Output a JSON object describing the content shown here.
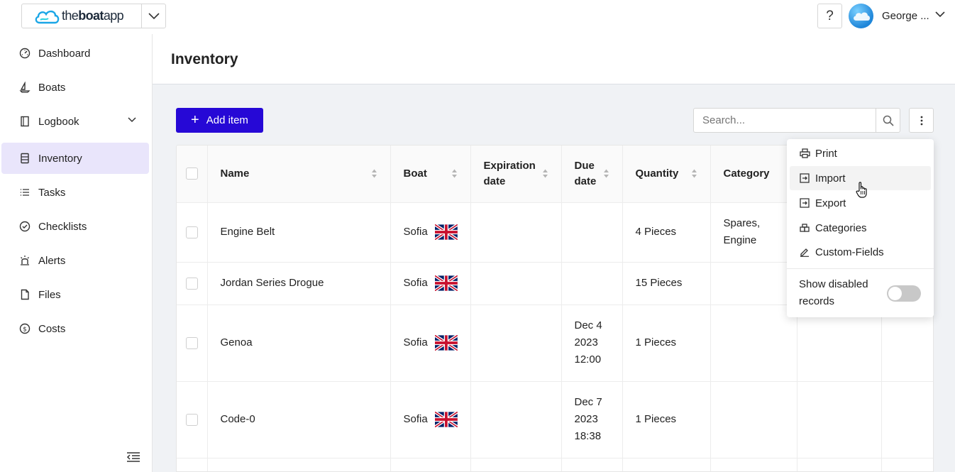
{
  "brand": {
    "prefix": "the",
    "bold": "boat",
    "suffix": "app"
  },
  "header": {
    "help_label": "?",
    "user_name": "George ..."
  },
  "sidebar": {
    "items": [
      {
        "label": "Dashboard",
        "icon": "gauge-icon"
      },
      {
        "label": "Boats",
        "icon": "sailboat-icon"
      },
      {
        "label": "Logbook",
        "icon": "book-icon"
      },
      {
        "label": "Inventory",
        "icon": "list-icon",
        "active": true
      },
      {
        "label": "Tasks",
        "icon": "tasks-icon"
      },
      {
        "label": "Checklists",
        "icon": "check-circle-icon"
      },
      {
        "label": "Alerts",
        "icon": "siren-icon"
      },
      {
        "label": "Files",
        "icon": "file-icon"
      },
      {
        "label": "Costs",
        "icon": "dollar-circle-icon"
      }
    ]
  },
  "page": {
    "title": "Inventory"
  },
  "toolbar": {
    "add_label": "Add item",
    "search_placeholder": "Search..."
  },
  "table": {
    "columns": [
      {
        "label": "Name"
      },
      {
        "label": "Boat"
      },
      {
        "label": "Expiration date"
      },
      {
        "label": "Due date"
      },
      {
        "label": "Quantity"
      },
      {
        "label": "Category"
      }
    ],
    "rows": [
      {
        "name": "Engine Belt",
        "boat": "Sofia",
        "expiration": "",
        "due": "",
        "quantity": "4 Pieces",
        "category": "Spares, Engine"
      },
      {
        "name": "Jordan Series Drogue",
        "boat": "Sofia",
        "expiration": "",
        "due": "",
        "quantity": "15 Pieces",
        "category": ""
      },
      {
        "name": "Genoa",
        "boat": "Sofia",
        "expiration": "",
        "due": "Dec 4 2023 12:00",
        "quantity": "1 Pieces",
        "category": ""
      },
      {
        "name": "Code-0",
        "boat": "Sofia",
        "expiration": "",
        "due": "Dec 7 2023 18:38",
        "quantity": "1 Pieces",
        "category": ""
      }
    ]
  },
  "menu": {
    "items": [
      {
        "label": "Print",
        "icon": "printer-icon"
      },
      {
        "label": "Import",
        "icon": "import-icon"
      },
      {
        "label": "Export",
        "icon": "export-icon"
      },
      {
        "label": "Categories",
        "icon": "categories-icon"
      },
      {
        "label": "Custom-Fields",
        "icon": "pencil-icon"
      }
    ],
    "toggle_label": "Show disabled records",
    "toggle_on": false
  },
  "colors": {
    "accent": "#2608d6",
    "active_nav": "#e9e5fb",
    "content_bg": "#f0f2f5"
  }
}
